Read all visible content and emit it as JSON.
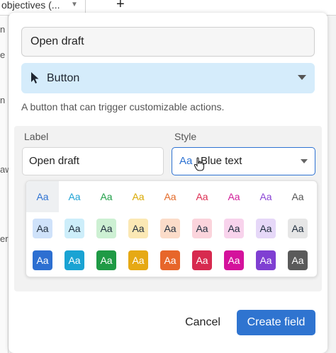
{
  "background": {
    "column_header": "objectives (...",
    "add_column_glyph": "+",
    "left_fragments": [
      "n",
      "e",
      "n",
      "aw",
      "er"
    ]
  },
  "modal": {
    "field_name_value": "Open draft",
    "field_type": {
      "icon": "cursor-arrow-icon",
      "label": "Button"
    },
    "description": "A button that can trigger customizable actions.",
    "label_section": {
      "label": "Label",
      "value": "Open draft"
    },
    "style_section": {
      "label": "Style",
      "selected_swatch": "Aa",
      "selected_value": "Blue text"
    },
    "palette": {
      "glyph": "Aa",
      "selected": "blue-text",
      "text_row": [
        {
          "id": "blue-text",
          "color": "#2d72d2"
        },
        {
          "id": "cyan-text",
          "color": "#1fa2d4"
        },
        {
          "id": "green-text",
          "color": "#22a04a"
        },
        {
          "id": "yellow-text",
          "color": "#d9a800"
        },
        {
          "id": "orange-text",
          "color": "#e36b2a"
        },
        {
          "id": "red-text",
          "color": "#dc2e52"
        },
        {
          "id": "pink-text",
          "color": "#d1209a"
        },
        {
          "id": "purple-text",
          "color": "#8a44d4"
        },
        {
          "id": "gray-text",
          "color": "#555555"
        }
      ],
      "light_row": [
        {
          "id": "blue-light",
          "bg": "#cfe2fa",
          "fg": "#1f2d3d"
        },
        {
          "id": "cyan-light",
          "bg": "#cdeefa",
          "fg": "#1f2d3d"
        },
        {
          "id": "green-light",
          "bg": "#cdf0d3",
          "fg": "#1f2d3d"
        },
        {
          "id": "yellow-light",
          "bg": "#fbe8b4",
          "fg": "#1f2d3d"
        },
        {
          "id": "orange-light",
          "bg": "#fbdcc9",
          "fg": "#1f2d3d"
        },
        {
          "id": "red-light",
          "bg": "#fbd4dc",
          "fg": "#1f2d3d"
        },
        {
          "id": "pink-light",
          "bg": "#f8d3ec",
          "fg": "#1f2d3d"
        },
        {
          "id": "purple-light",
          "bg": "#e6d8f8",
          "fg": "#1f2d3d"
        },
        {
          "id": "gray-light",
          "bg": "#e6e6e6",
          "fg": "#1f2d3d"
        }
      ],
      "solid_row": [
        {
          "id": "blue-solid",
          "bg": "#2d6fd1",
          "fg": "#ffffff"
        },
        {
          "id": "cyan-solid",
          "bg": "#1aa3d3",
          "fg": "#ffffff"
        },
        {
          "id": "green-solid",
          "bg": "#1f9a45",
          "fg": "#ffffff"
        },
        {
          "id": "yellow-solid",
          "bg": "#e6a915",
          "fg": "#ffffff"
        },
        {
          "id": "orange-solid",
          "bg": "#e7662a",
          "fg": "#ffffff"
        },
        {
          "id": "red-solid",
          "bg": "#d72a4f",
          "fg": "#ffffff"
        },
        {
          "id": "pink-solid",
          "bg": "#d4129c",
          "fg": "#ffffff"
        },
        {
          "id": "purple-solid",
          "bg": "#7f3fd2",
          "fg": "#ffffff"
        },
        {
          "id": "gray-solid",
          "bg": "#5a5a5a",
          "fg": "#ffffff"
        }
      ]
    },
    "buttons": {
      "cancel": "Cancel",
      "create": "Create field"
    }
  }
}
